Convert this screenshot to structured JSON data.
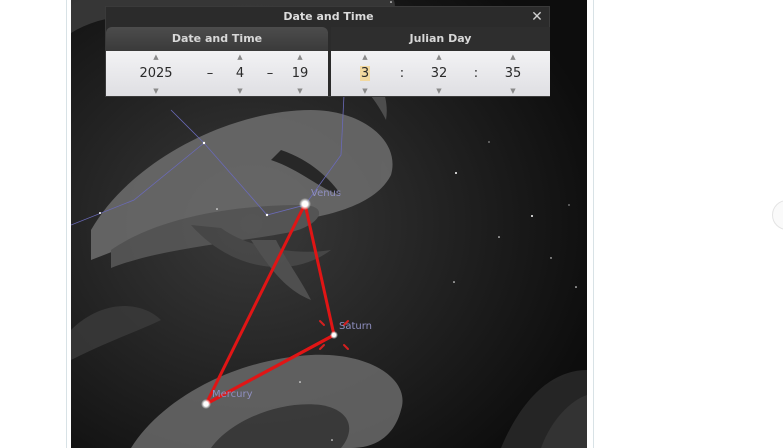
{
  "dialog": {
    "title": "Date and Time",
    "close_symbol": "✕",
    "tabs": [
      {
        "label": "Date and Time",
        "active": true
      },
      {
        "label": "Julian Day",
        "active": false
      }
    ],
    "date": {
      "year": "2025",
      "month": "4",
      "day": "19",
      "separator": "–"
    },
    "time": {
      "hour": "3",
      "minute": "32",
      "second": "35",
      "separator": ":"
    },
    "spin_up_symbol": "▲",
    "spin_down_symbol": "▼"
  },
  "sky": {
    "planets": [
      {
        "name": "Venus"
      },
      {
        "name": "Saturn"
      },
      {
        "name": "Mercury"
      }
    ],
    "colors": {
      "background": "#0d0d0d",
      "triangle": "#e01515",
      "constellation_lines": "#6a6ab8",
      "planet_label": "#8f8fc0",
      "saturn_marker": "#d42020"
    }
  }
}
